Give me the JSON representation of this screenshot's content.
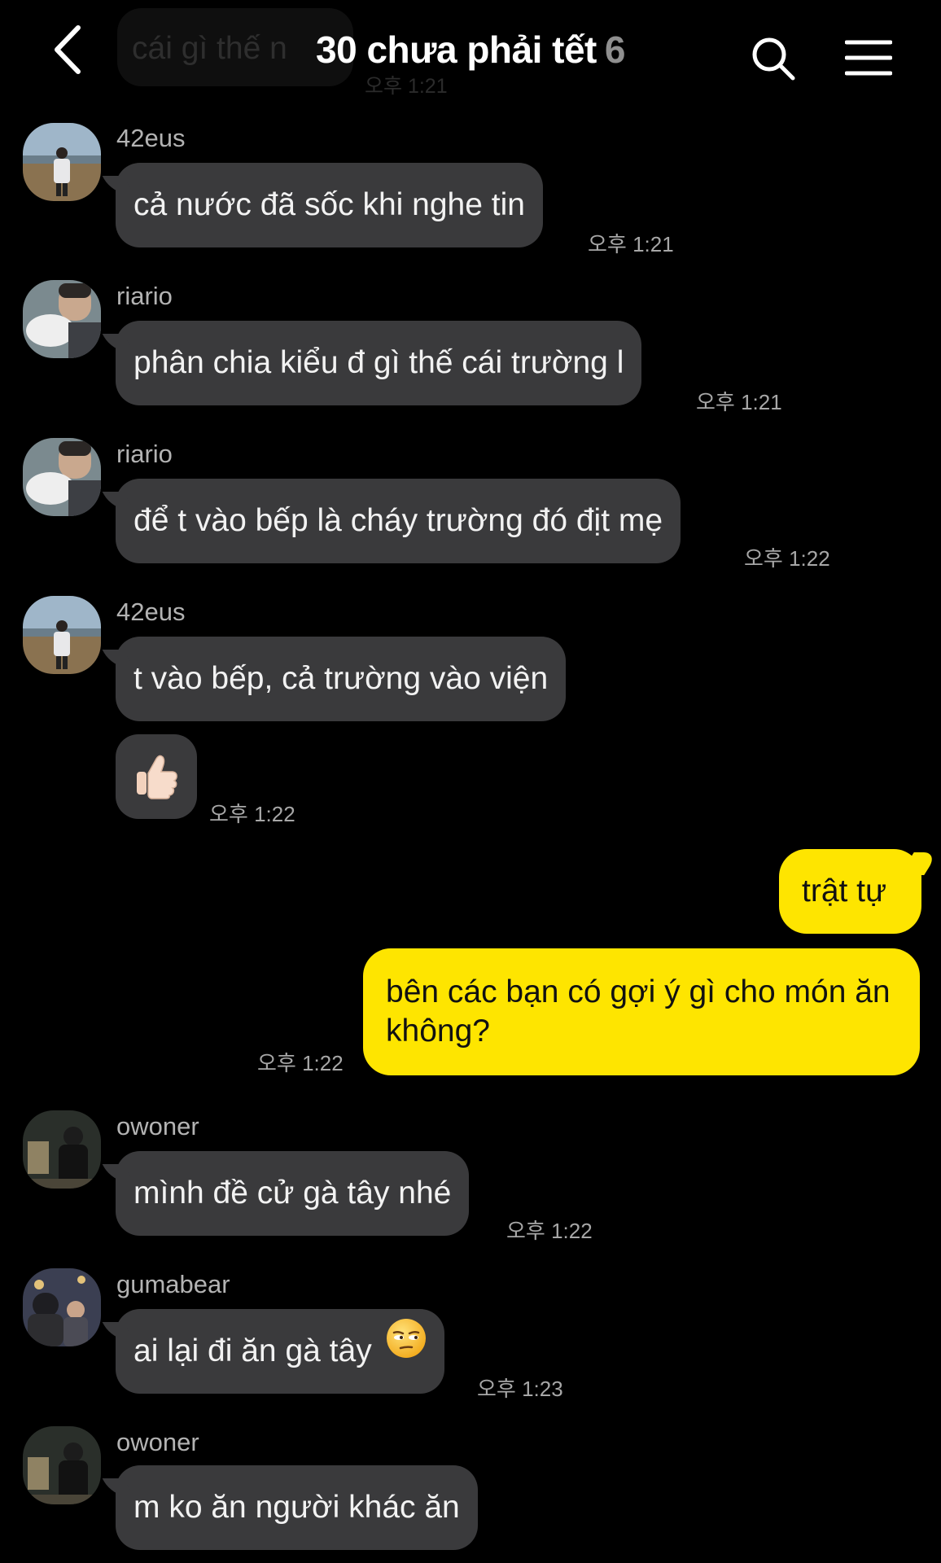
{
  "header": {
    "title": "30 chưa phải tết",
    "member_count": "6",
    "behind_text": "cái gì thế n",
    "behind_time": "오후 1:21"
  },
  "messages": [
    {
      "sender": "42eus",
      "text": "cả nước đã sốc khi nghe tin",
      "time": "오후 1:21",
      "avatar": "photo-42eus"
    },
    {
      "sender": "riario",
      "text": "phân chia kiểu đ gì thế cái trường l",
      "time": "오후 1:21",
      "avatar": "photo-riario"
    },
    {
      "sender": "riario",
      "text": "để t vào bếp là cháy trường đó địt mẹ",
      "time": "오후 1:22",
      "avatar": "photo-riario"
    },
    {
      "sender": "42eus",
      "text": "t vào bếp, cả trường vào viện",
      "avatar": "photo-42eus"
    },
    {
      "sender": "42eus",
      "emoji": "thumbs-up",
      "time": "오후 1:22"
    },
    {
      "sender": "me",
      "text": "trật tự"
    },
    {
      "sender": "me",
      "text": "bên các bạn có gợi ý gì cho món ăn không?",
      "time": "오후 1:22"
    },
    {
      "sender": "owoner",
      "text": "mình đề cử gà tây nhé",
      "time": "오후 1:22",
      "avatar": "photo-owoner"
    },
    {
      "sender": "gumabear",
      "text": "ai lại đi ăn gà tây",
      "emoji": "unamused-face",
      "time": "오후 1:23",
      "avatar": "photo-gumabear"
    },
    {
      "sender": "owoner",
      "text": "m ko ăn người khác ăn",
      "avatar": "photo-owoner"
    }
  ],
  "colors": {
    "background": "#000000",
    "incoming_bubble": "#3a3a3c",
    "outgoing_bubble": "#fee500",
    "timestamp": "#a7a7a7"
  }
}
